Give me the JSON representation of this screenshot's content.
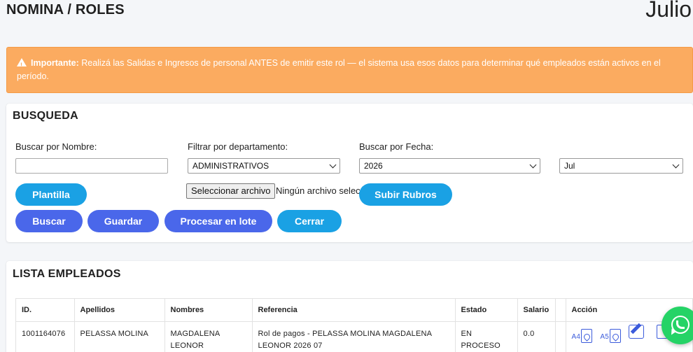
{
  "header": {
    "title": "NOMINA / ROLES",
    "month": "Julio"
  },
  "alert": {
    "strong": "Importante:",
    "text": " Realizá las Salidas e Ingresos de personal ANTES de emitir este rol — el sistema usa esos datos para determinar qué empleados están activos en el período."
  },
  "busqueda": {
    "title": "BUSQUEDA",
    "nombre_label": "Buscar por Nombre:",
    "nombre_value": "",
    "depto_label": "Filtrar por departamento:",
    "depto_value": "ADMINISTRATIVOS",
    "fecha_label": "Buscar por Fecha:",
    "anio_value": "2026",
    "mes_value": "Jul",
    "file_button": "Seleccionar archivo",
    "file_none": "Ningún archivo seleccionado",
    "buttons": {
      "plantilla": "Plantilla",
      "subir_rubros": "Subir Rubros",
      "buscar": "Buscar",
      "guardar": "Guardar",
      "procesar": "Procesar en lote",
      "cerrar": "Cerrar"
    },
    "colors": {
      "cyan": "#1aa1e4",
      "blue": "#4a67ea"
    }
  },
  "lista": {
    "title": "LISTA EMPLEADOS",
    "columns": [
      "ID.",
      "Apellidos",
      "Nombres",
      "Referencia",
      "Estado",
      "Salario",
      "",
      "Acción"
    ],
    "rows": [
      {
        "id": "1001164076",
        "apellidos": "PELASSA MOLINA",
        "nombres": "MAGDALENA LEONOR",
        "referencia": "Rol de pagos - PELASSA MOLINA MAGDALENA LEONOR 2026 07",
        "estado": "EN PROCESO",
        "salario": "0.0"
      }
    ],
    "action_labels": {
      "a4": "A4",
      "a5": "A5"
    }
  },
  "icons": [
    "warning-icon",
    "pdf-a4-icon",
    "pdf-a5-icon",
    "edit-icon",
    "delete-icon",
    "whatsapp-icon",
    "chevron-down-icon"
  ]
}
